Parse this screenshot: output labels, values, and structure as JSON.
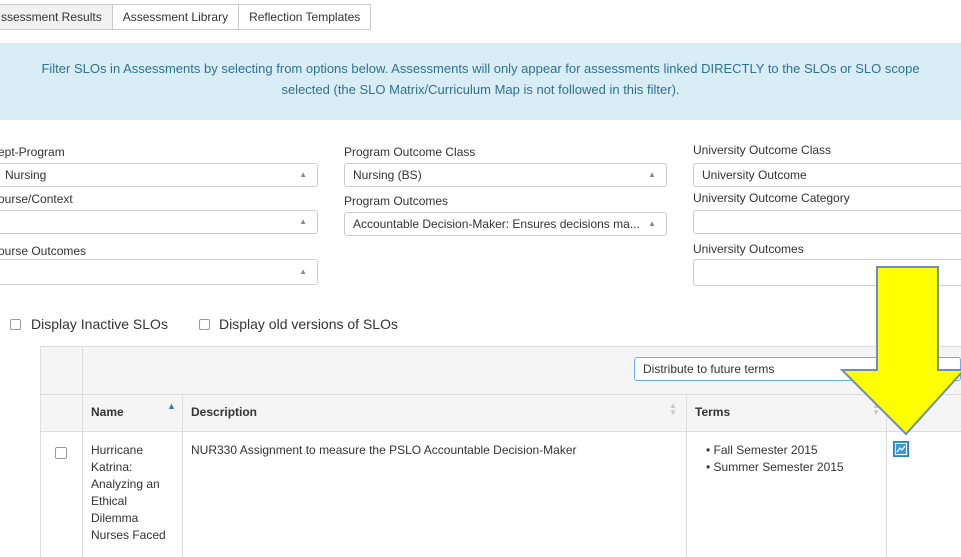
{
  "tabs": [
    {
      "label": "ssessment Results",
      "active": true
    },
    {
      "label": "Assessment Library",
      "active": false
    },
    {
      "label": "Reflection Templates",
      "active": false
    }
  ],
  "banner": {
    "line1": "Filter SLOs in Assessments by selecting from options below. Assessments will only appear for assessments linked DIRECTLY to the SLOs or SLO scope",
    "line2": "selected (the SLO Matrix/Curriculum Map is not followed in this filter)."
  },
  "filters": {
    "dept_program": {
      "label": "ept-Program",
      "value": "Nursing"
    },
    "course_context": {
      "label": "ourse/Context",
      "value": ""
    },
    "course_outcomes": {
      "label": "ourse Outcomes",
      "value": ""
    },
    "program_outcome_class": {
      "label": "Program Outcome Class",
      "value": "Nursing (BS)"
    },
    "program_outcomes": {
      "label": "Program Outcomes",
      "value": "Accountable Decision-Maker: Ensures decisions ma..."
    },
    "university_outcome_class": {
      "label": "University Outcome Class",
      "value": "University Outcome"
    },
    "university_outcome_category": {
      "label": "University Outcome Category",
      "value": ""
    },
    "university_outcomes": {
      "label": "University Outcomes",
      "value": ""
    }
  },
  "options": {
    "inactive_label": "Display Inactive SLOs",
    "old_versions_label": "Display old versions of SLOs"
  },
  "table": {
    "distribute_label": "Distribute to future terms",
    "headers": {
      "name": "Name",
      "description": "Description",
      "terms": "Terms"
    },
    "rows": [
      {
        "name_lines": [
          "Hurricane",
          "Katrina:",
          "Analyzing an",
          "Ethical",
          "Dilemma",
          "Nurses Faced"
        ],
        "description": "NUR330 Assignment to measure the PSLO Accountable Decision-Maker",
        "terms": [
          "Fall Semester 2015",
          "Summer Semester 2015"
        ]
      }
    ]
  },
  "icons": {
    "select_arrow": "triangle-up",
    "sort_asc": "triangle-up",
    "chart": "line-chart-icon",
    "annotation": "yellow-down-arrow"
  },
  "colors": {
    "banner_bg": "#d9edf7",
    "banner_text": "#31708f",
    "annotation_arrow": "#ffff00",
    "chart_button": "#3a9ad9"
  }
}
